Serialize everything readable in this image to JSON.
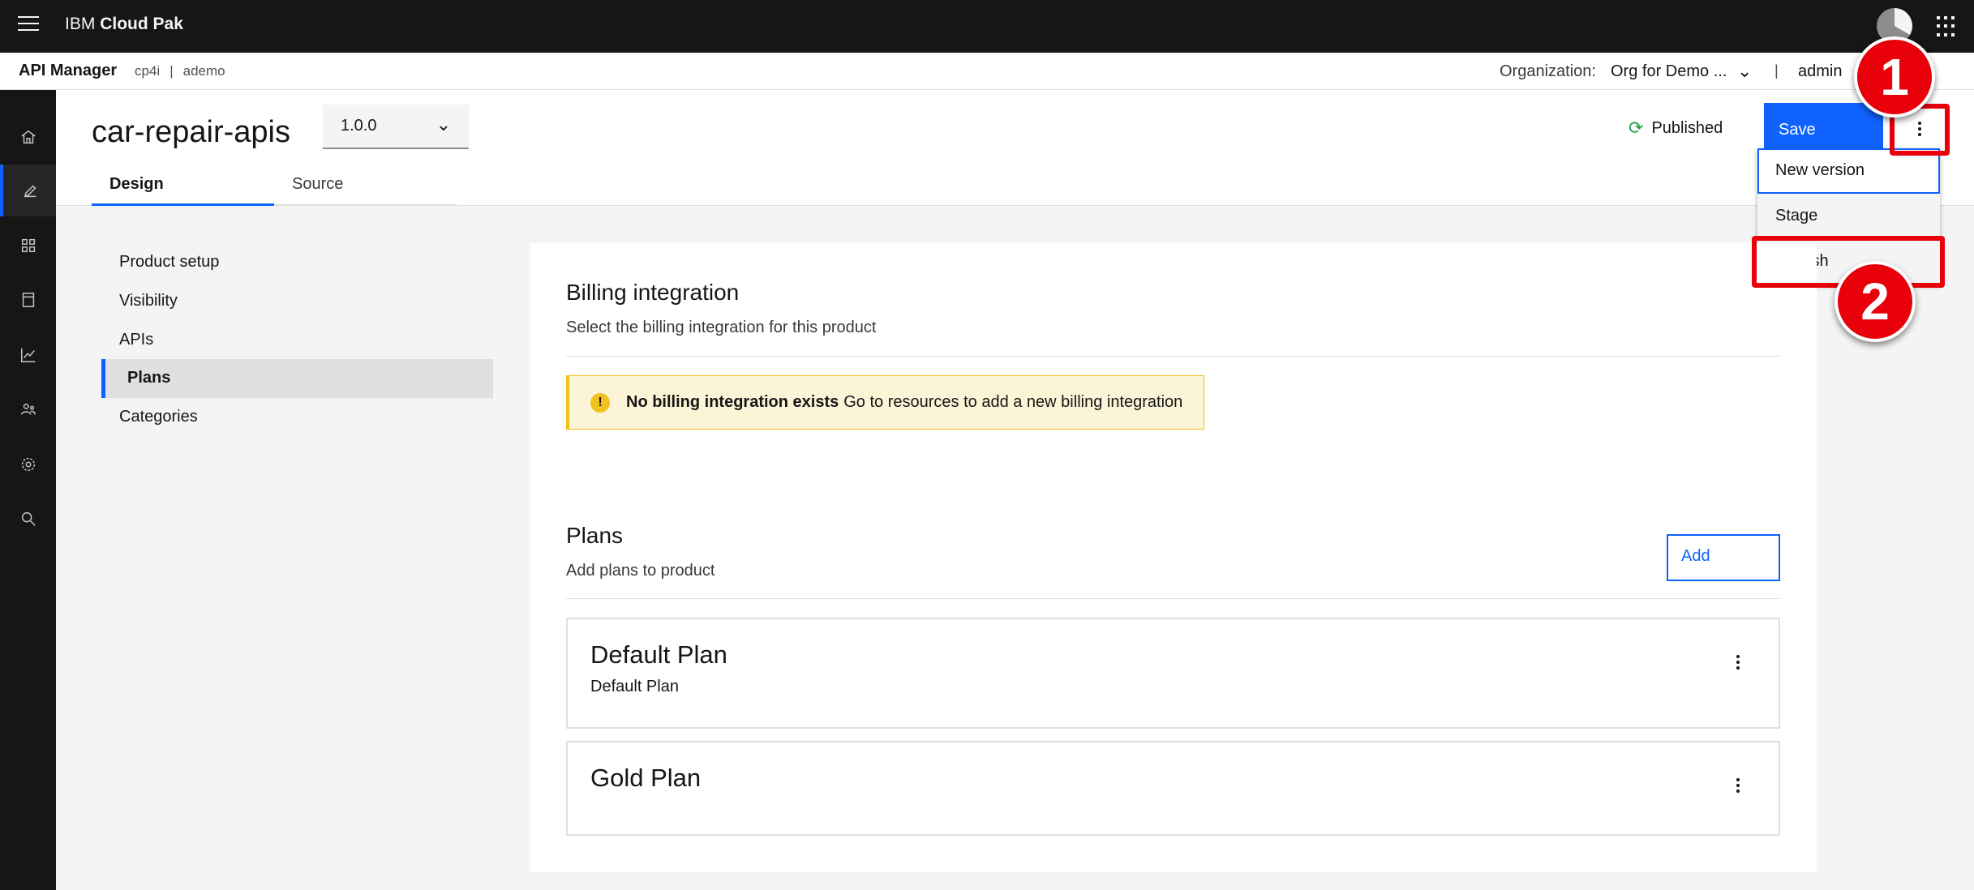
{
  "topbar": {
    "brand_prefix": "IBM",
    "brand_name": "Cloud Pak",
    "menu_icon": "hamburger-icon",
    "switcher_icon": "app-switcher-icon"
  },
  "subheader": {
    "app_name": "API Manager",
    "crumbs": [
      "cp4i",
      "ademo"
    ],
    "org_label": "Organization:",
    "org_value": "Org for Demo ...",
    "separator": "|",
    "user": "admin"
  },
  "rail": [
    "home-icon",
    "develop-icon",
    "manage-icon",
    "catalog-icon",
    "analytics-icon",
    "members-icon",
    "settings-icon",
    "search-icon"
  ],
  "header": {
    "title": "car-repair-apis",
    "version": "1.0.0",
    "tabs": [
      {
        "label": "Design"
      },
      {
        "label": "Source"
      }
    ],
    "status": "Published",
    "save_label": "Save"
  },
  "menu": {
    "items": [
      "New version",
      "Stage",
      "Publish"
    ]
  },
  "callouts": [
    "1",
    "2"
  ],
  "nav": {
    "items": [
      "Product setup",
      "Visibility",
      "APIs",
      "Plans",
      "Categories"
    ],
    "active": "Plans"
  },
  "billing": {
    "title": "Billing integration",
    "subtitle": "Select the billing integration for this product",
    "notice_title": "No billing integration exists",
    "notice_text": "Go to resources to add a new billing integration"
  },
  "plans": {
    "title": "Plans",
    "subtitle": "Add plans to product",
    "add_label": "Add",
    "items": [
      {
        "name": "Default Plan",
        "description": "Default Plan"
      },
      {
        "name": "Gold Plan",
        "description": ""
      }
    ]
  },
  "colors": {
    "accent": "#0f62fe",
    "callout": "#e8000b",
    "warning": "#f1c21b",
    "success": "#24a148"
  }
}
